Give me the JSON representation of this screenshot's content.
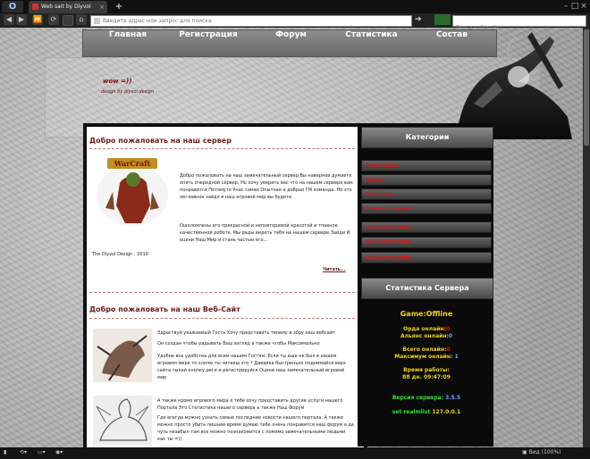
{
  "browser": {
    "opera_label": "O",
    "tab_title": "Web sait by Diyvol",
    "tab_close": "×",
    "new_tab": "+",
    "window_controls": [
      "–",
      "□",
      "×"
    ],
    "address_placeholder": "Введите адрес или запрос для поиска",
    "search_placeholder": "Поиск в Google",
    "go_icon": "go-arrow-icon",
    "zoom": "Вид (100%)"
  },
  "nav": {
    "items": [
      "Главная",
      "Регистрация",
      "Форум",
      "Статистика",
      "Состав"
    ]
  },
  "header": {
    "title": "wow =))",
    "subtitle": "design by diyvol design"
  },
  "posts": [
    {
      "title": "Добро пожаловать на наш сервер",
      "para1": "Добро пожаловать на наш замечательный сервер,Вы наверное думаете опять очередной сервер, Но хочу уверить вас что на нашем сервере вам понравится Потомуто Унас самая Опытная и добрая ГМ команда. Но это неглавное зайдя в наш игровой мир вы будете.",
      "para2": "Ошоломлены его прекрасной и неповторимой красотой и тпаеное качественной роботе. Мы рады видеть тебя на нашем сервере Зайди И оцени Наш Мир и стань частью его...",
      "credit": "The Diyvol Design : 2010",
      "readmore": "Читать..."
    },
    {
      "title": "Добро пожаловать на наш Веб-Сайт",
      "p1": "Здраствуй уважаемый Гость Хочу представить твоему в зору наш вебсайт",
      "p2": "Он создан чтобы радывать Ваш взгляд а также чтобы Максимально",
      "p3": "Удобне все удобства для всем нашим Гостям. Если ты еще не был в нашем игровом мире то хлочю ты читаеш это ? Давайка быстренько поднимайся верх сайта тыкай кнопку реги и регистрируйся Оцени наш замечательный игровой мир",
      "p4": "А также кроме игрового мира я тебе хочу представить другие услуги нашего Портала Это Статистика нашего сервера а также Наш Форум",
      "p5": "Где всегда можно узнать самые последние новости нашего портала. А также можно просто убить лишнее время думаю тебе очень понравится наш форум а да чуть незабыл там все можно познакомится с помимо замечательными людьми как ты =))"
    }
  ],
  "sidebar": {
    "categories_title": "Категории",
    "categories": [
      "Регистрация",
      "Форум",
      "Статистика",
      "Главная страница",
      "ВАШ ЗАГОЛОВОК",
      "ВАШ ЗАГОЛОВОК",
      "ВАШ ЗАГОЛОВОК"
    ],
    "stats_title": "Статистика Сервера",
    "game_label": "Game:",
    "game_status": "Offline",
    "horde_label": "Орда онлайн:",
    "horde_value": "0",
    "alliance_label": "Альянс онлайн:",
    "alliance_value": "0",
    "total_label": "Всего онлайн:",
    "total_value": "0",
    "max_label": "Максимум онлайн:",
    "max_value": "1",
    "uptime_label": "Время работы:",
    "uptime_value": "88 дн. 09:47:09",
    "version_label": "Версия сервера:",
    "version_value": "3.5.5",
    "realm_label": "set realmlist",
    "realm_value": "127.0.0.1"
  },
  "colors": {
    "accent_red": "#e01010",
    "post_title": "#6b1a1a",
    "stat_yellow": "#f2d21a",
    "stat_green": "#2ee22e",
    "stat_blue": "#7aa0ff"
  }
}
